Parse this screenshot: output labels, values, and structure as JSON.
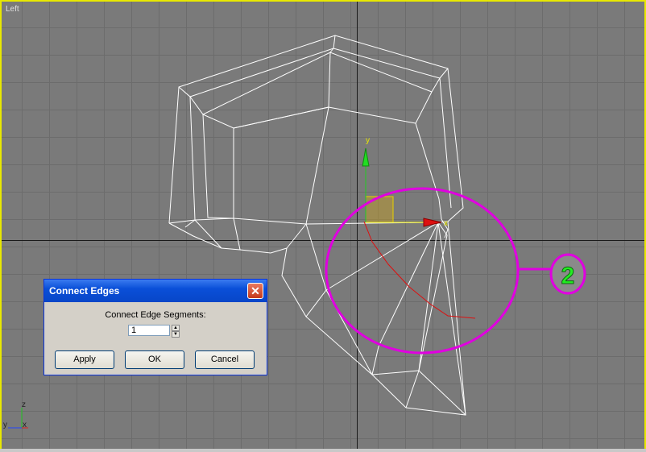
{
  "viewport": {
    "label": "Left",
    "border_color": "#e8e800",
    "grid_color": "#7a7a7a"
  },
  "gizmo": {
    "y_label": "y",
    "x_label": "x"
  },
  "callout": {
    "number": "2",
    "color": "#e000e0",
    "number_color": "#22ee22"
  },
  "corner_axes": {
    "z_label": "z",
    "y_label": "y",
    "x_label": "x"
  },
  "dialog": {
    "title": "Connect Edges",
    "close_icon": "close-icon",
    "segments_label": "Connect Edge Segments:",
    "segments_value": "1",
    "apply_label": "Apply",
    "ok_label": "OK",
    "cancel_label": "Cancel"
  }
}
